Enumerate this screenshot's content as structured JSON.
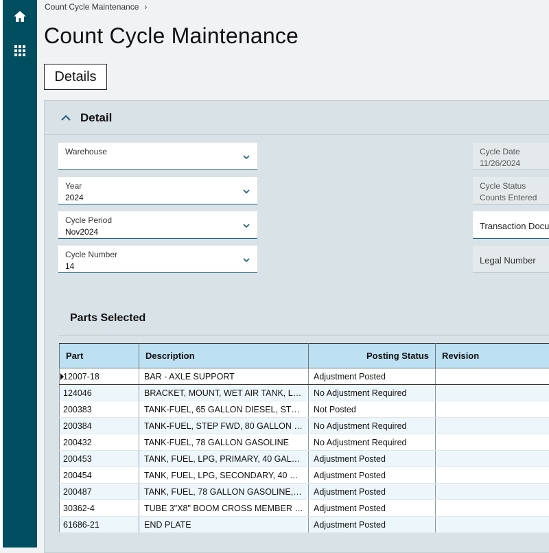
{
  "breadcrumb": {
    "item": "Count Cycle Maintenance"
  },
  "page": {
    "title": "Count Cycle Maintenance"
  },
  "tabs": {
    "details": "Details"
  },
  "panel": {
    "title": "Detail"
  },
  "fields": {
    "warehouse": {
      "label": "Warehouse",
      "value": ""
    },
    "year": {
      "label": "Year",
      "value": "2024"
    },
    "cycle_period": {
      "label": "Cycle Period",
      "value": "Nov2024"
    },
    "cycle_number": {
      "label": "Cycle Number",
      "value": "14"
    },
    "cycle_date": {
      "label": "Cycle Date",
      "value": "11/26/2024"
    },
    "cycle_status": {
      "label": "Cycle Status",
      "value": "Counts Entered"
    },
    "transaction_document": {
      "label": "Transaction Docu"
    },
    "legal_number": {
      "label": "Legal Number"
    }
  },
  "parts_section": {
    "title": "Parts Selected"
  },
  "grid": {
    "columns": [
      "Part",
      "Description",
      "Posting Status",
      "Revision"
    ],
    "rows": [
      {
        "part": "12007-18",
        "description": "BAR - AXLE SUPPORT",
        "status": "Adjustment Posted",
        "revision": ""
      },
      {
        "part": "124046",
        "description": "BRACKET, MOUNT, WET AIR TANK, LH...",
        "status": "No Adjustment Required",
        "revision": ""
      },
      {
        "part": "200383",
        "description": "TANK-FUEL, 65 GALLON DIESEL, STEP ...",
        "status": "Not Posted",
        "revision": ""
      },
      {
        "part": "200384",
        "description": "TANK-FUEL, STEP FWD, 80 GALLON DI...",
        "status": "No Adjustment Required",
        "revision": ""
      },
      {
        "part": "200432",
        "description": "TANK-FUEL, 78 GALLON GASOLINE",
        "status": "No Adjustment Required",
        "revision": ""
      },
      {
        "part": "200453",
        "description": "TANK, FUEL, LPG, PRIMARY, 40 GALLO...",
        "status": "Adjustment Posted",
        "revision": ""
      },
      {
        "part": "200454",
        "description": "TANK, FUEL, LPG, SECONDARY, 40 GAL...",
        "status": "Adjustment Posted",
        "revision": ""
      },
      {
        "part": "200487",
        "description": "TANK, FUEL, 78 GALLON GASOLINE, A...",
        "status": "Adjustment Posted",
        "revision": ""
      },
      {
        "part": "30362-4",
        "description": "TUBE 3\"X8\" BOOM CROSS MEMBER P...",
        "status": "Adjustment Posted",
        "revision": ""
      },
      {
        "part": "61686-21",
        "description": "END PLATE",
        "status": "Adjustment Posted",
        "revision": ""
      }
    ]
  },
  "colors": {
    "sidebar": "#004e60",
    "header_row": "#bde0f2",
    "accent": "#1d5f7a"
  }
}
